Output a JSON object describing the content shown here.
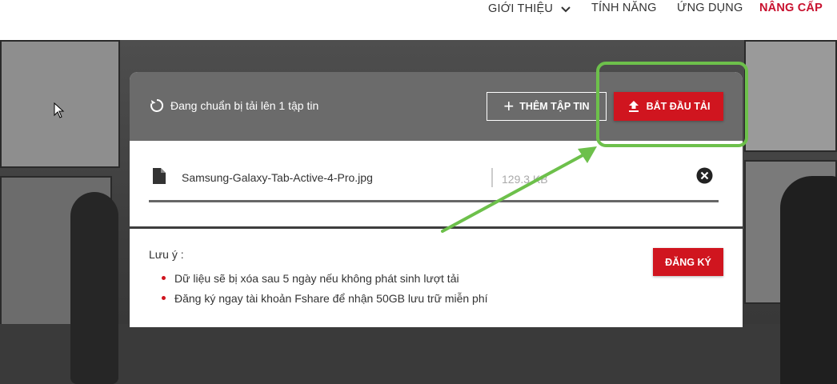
{
  "nav": {
    "items": [
      "GIỚI THIỆU",
      "TÍNH NĂNG",
      "ỨNG DỤNG",
      "NÂNG CẤP"
    ]
  },
  "upload": {
    "status": "Đang chuẩn bị tải lên 1 tập tin",
    "add_button": "THÊM TẬP TIN",
    "start_button": "BẮT ĐẦU TẢI"
  },
  "file": {
    "name": "Samsung-Galaxy-Tab-Active-4-Pro.jpg",
    "size": "129.3 KB"
  },
  "notes": {
    "title": "Lưu ý :",
    "items": [
      "Dữ liệu sẽ bị xóa sau 5 ngày nếu không phát sinh lượt tải",
      "Đăng ký ngay tài khoản Fshare để nhận 50GB lưu trữ miễn phí"
    ],
    "register_button": "ĐĂNG KÝ"
  },
  "colors": {
    "accent": "#d0151f",
    "highlight": "#6dc04b"
  }
}
